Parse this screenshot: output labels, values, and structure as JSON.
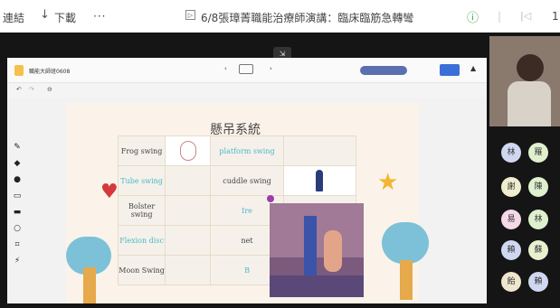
{
  "topbar": {
    "link_label": "連結",
    "download_label": "下載",
    "more_label": "···",
    "meeting_title": "6/8張璋菁職能治療師演講：臨床臨筋急轉彎",
    "page_number": "1"
  },
  "app": {
    "file_name": "職能大師班0608"
  },
  "slide": {
    "title": "懸吊系統",
    "rows": [
      [
        "Frog swing",
        "",
        "platform swing",
        ""
      ],
      [
        "Tube swing",
        "",
        "cuddle swing",
        ""
      ],
      [
        "Bolster swing",
        "",
        "Ire",
        ""
      ],
      [
        "Flexion disc",
        "",
        "net",
        ""
      ],
      [
        "Moon Swing",
        "",
        "B",
        ""
      ]
    ]
  },
  "participants": [
    {
      "initial": "林",
      "color": "#cfd8f0"
    },
    {
      "initial": "羅",
      "color": "#dff0cf"
    },
    {
      "initial": "謝",
      "color": "#f0edcf"
    },
    {
      "initial": "陳",
      "color": "#dff0cf"
    },
    {
      "initial": "易",
      "color": "#f4d9e8"
    },
    {
      "initial": "林",
      "color": "#dff0cf"
    },
    {
      "initial": "賴",
      "color": "#cfd8f0"
    },
    {
      "initial": "蘇",
      "color": "#e8f0cf"
    },
    {
      "initial": "飴",
      "color": "#f0e6cf"
    },
    {
      "initial": "賴",
      "color": "#cfd8f0"
    }
  ]
}
